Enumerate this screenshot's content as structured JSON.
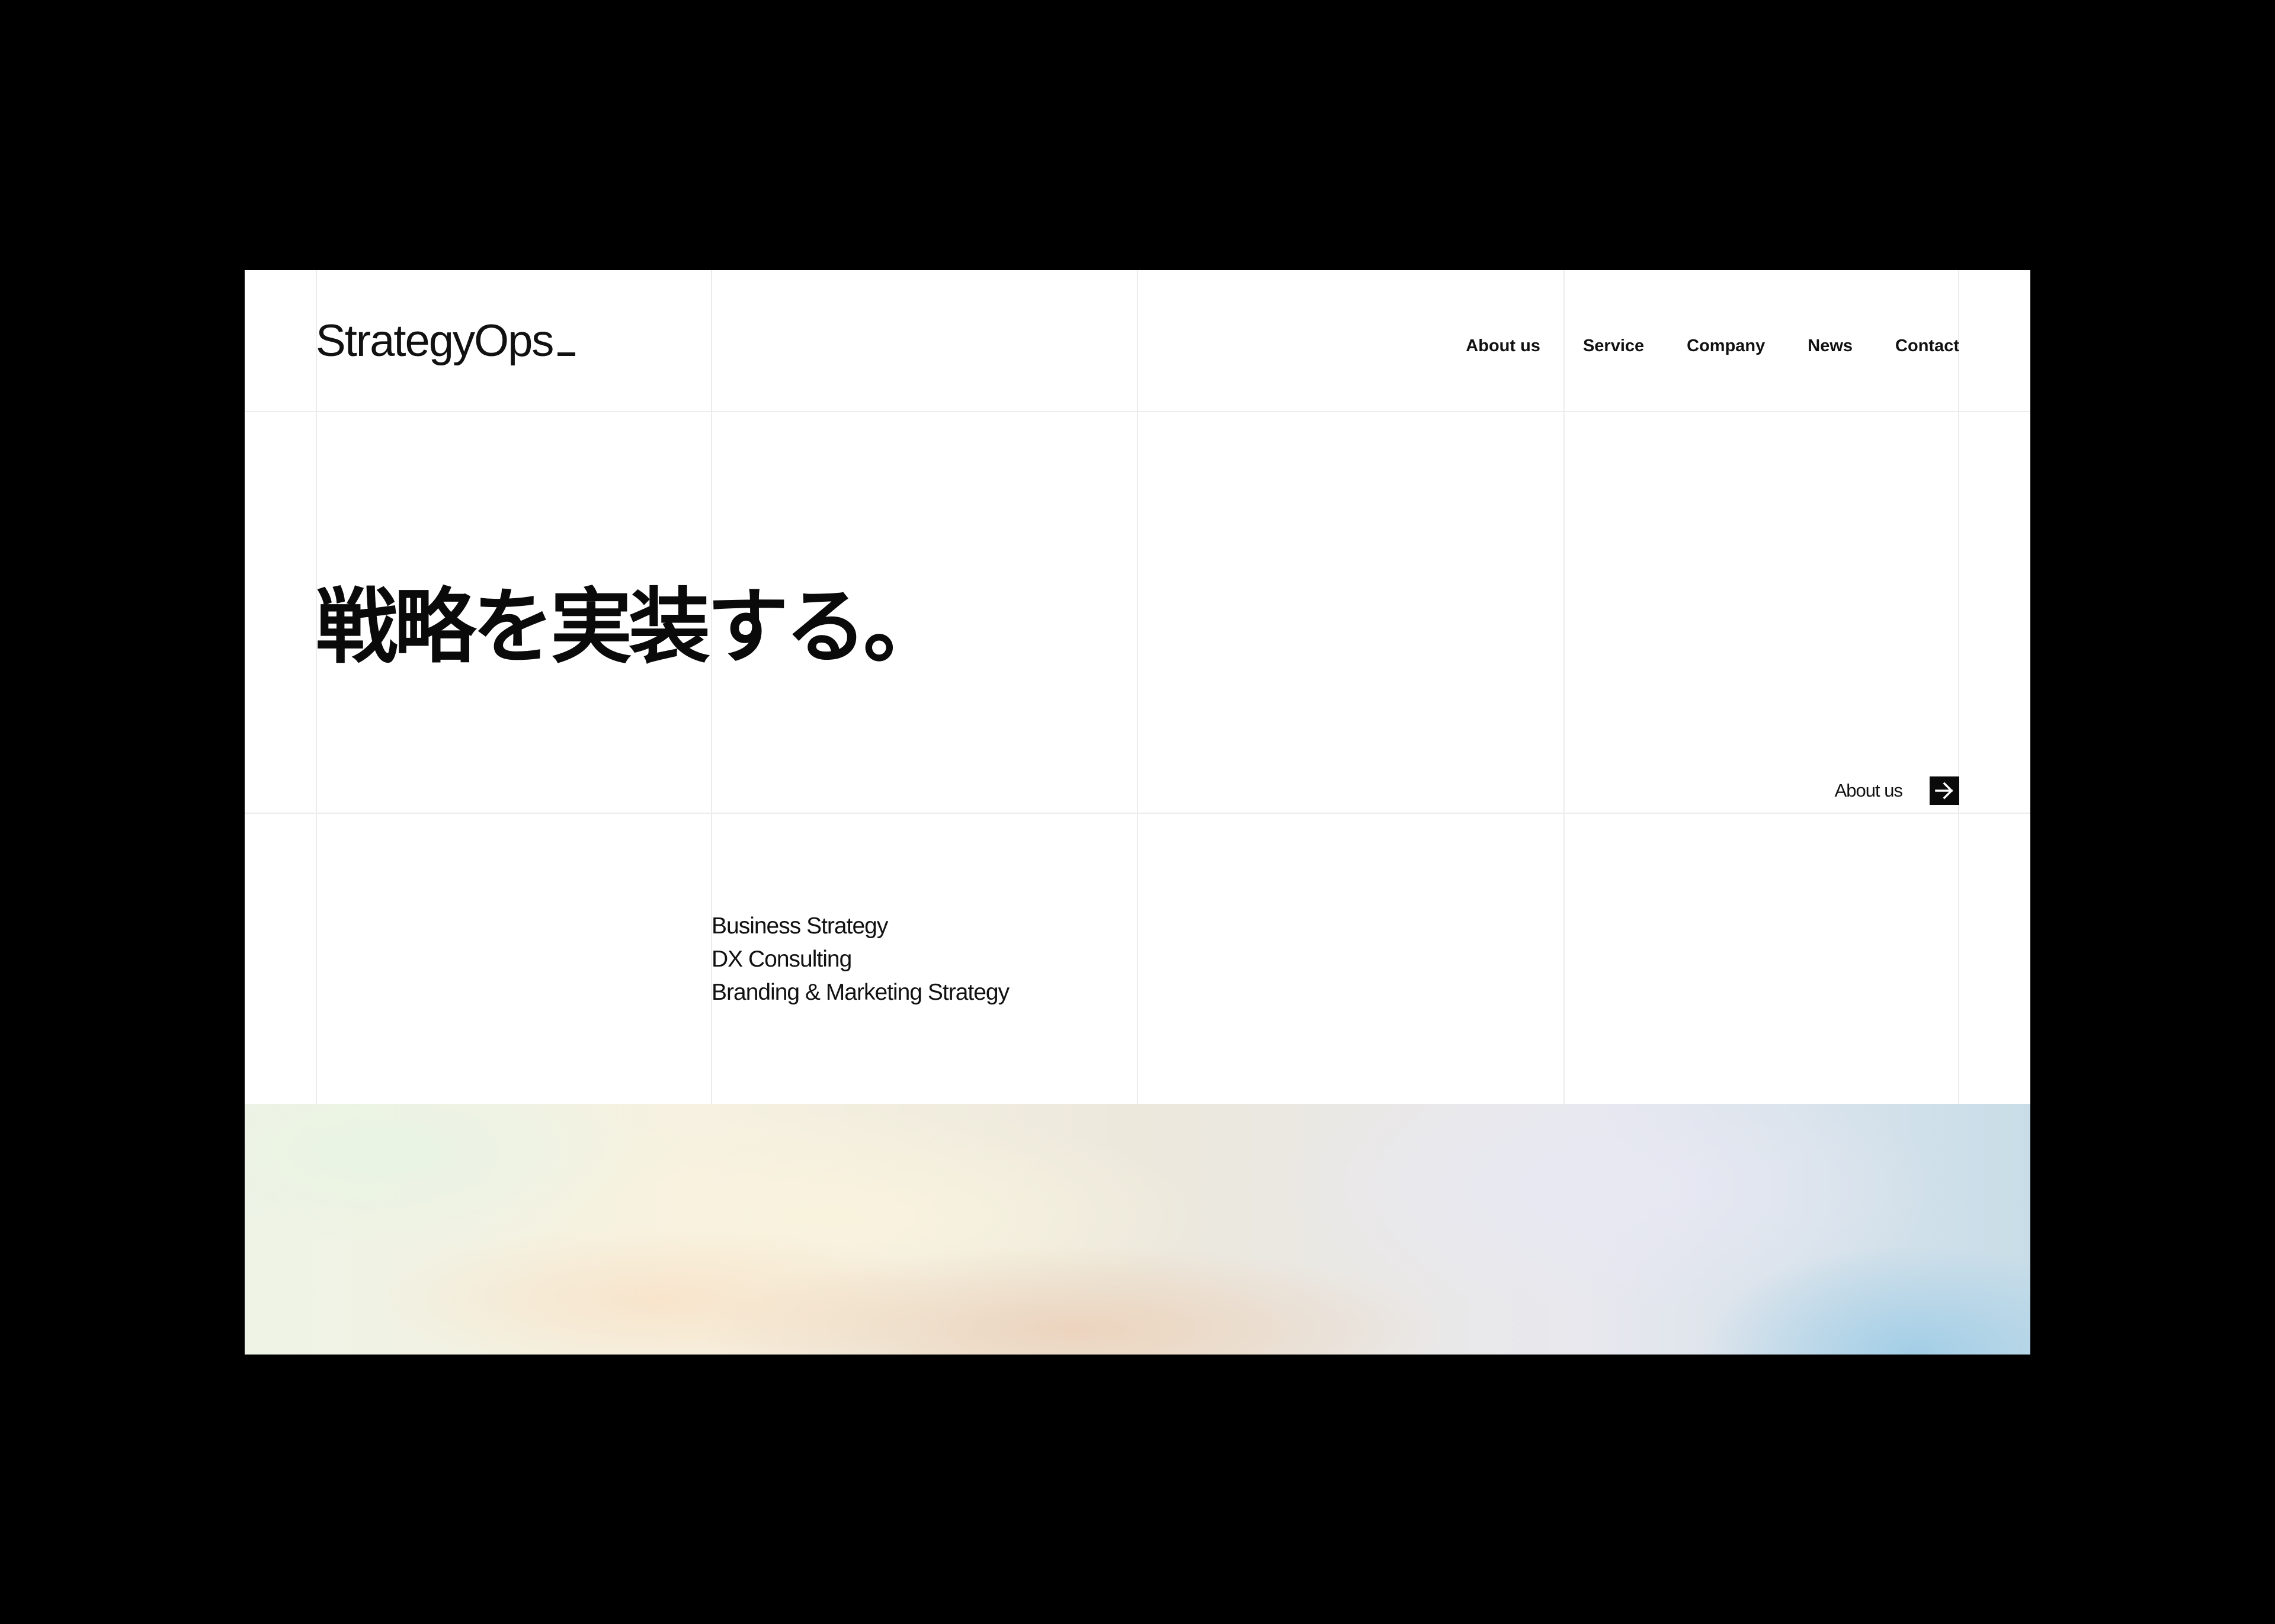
{
  "header": {
    "logo": "StrategyOps",
    "nav": [
      {
        "label": "About us"
      },
      {
        "label": "Service"
      },
      {
        "label": "Company"
      },
      {
        "label": "News"
      },
      {
        "label": "Contact"
      }
    ]
  },
  "hero": {
    "headline": "戦略を実装する。",
    "cta_label": "About us",
    "cta_icon": "arrow-right-icon"
  },
  "services": {
    "items": [
      {
        "label": "Business Strategy"
      },
      {
        "label": "DX Consulting"
      },
      {
        "label": "Branding & Marketing Strategy"
      }
    ]
  },
  "colors": {
    "background": "#000000",
    "page": "#ffffff",
    "text": "#111111",
    "grid": "#ececec",
    "accent": "#0a0a0a"
  }
}
